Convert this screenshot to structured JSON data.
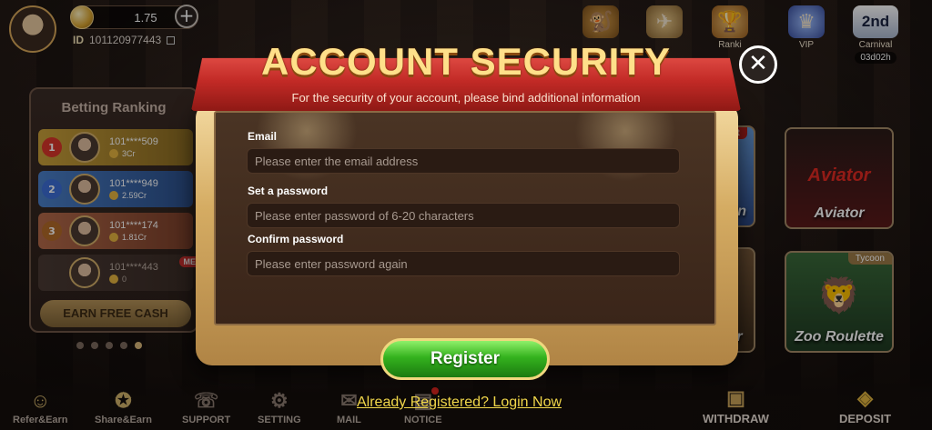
{
  "player": {
    "balance": "1.75",
    "id_label": "ID",
    "id_value": "101120977443"
  },
  "top_icons": {
    "ranking_label": "Ranki",
    "vip_label": "VIP",
    "carnival_badge": "2nd",
    "carnival_label": "Carnival",
    "carnival_timer": "03d02h"
  },
  "ranking": {
    "title": "Betting Ranking",
    "rows": [
      {
        "rank": "1",
        "name": "101****509",
        "amount": "3Cr"
      },
      {
        "rank": "2",
        "name": "101****949",
        "amount": "2.59Cr"
      },
      {
        "rank": "3",
        "name": "101****174",
        "amount": "1.81Cr"
      },
      {
        "rank": "",
        "name": "101****443",
        "amount": "0",
        "badge": "ME"
      }
    ],
    "earn_button": "EARN FREE CASH"
  },
  "games": {
    "hot_tag": "Hot",
    "tycoon_tag": "Tycoon",
    "partial_label_1": "oin",
    "aviator_logo": "Aviator",
    "aviator_label": "Aviator",
    "partial_label_2": "er",
    "zoo_label": "Zoo Roulette"
  },
  "bottom_nav": {
    "refer": "Refer&Earn",
    "share": "Share&Earn",
    "support": "SUPPORT",
    "setting": "SETTING",
    "mail": "MAIL",
    "notice": "NOTICE",
    "withdraw": "WITHDRAW",
    "deposit": "DEPOSIT"
  },
  "modal": {
    "title": "ACCOUNT SECURITY",
    "subtitle": "For the security of your account, please bind additional information",
    "email_label": "Email",
    "email_placeholder": "Please enter the email address",
    "password_label": "Set a password",
    "password_placeholder": "Please enter password of 6-20 characters",
    "confirm_label": "Confirm password",
    "confirm_placeholder": "Please enter password again",
    "register_button": "Register",
    "login_link": "Already Registered? Login Now"
  },
  "colors": {
    "ribbon_red": "#c22a26",
    "title_gold": "#ffe08a",
    "register_green": "#34b21e",
    "link_yellow": "#f1d74a"
  }
}
